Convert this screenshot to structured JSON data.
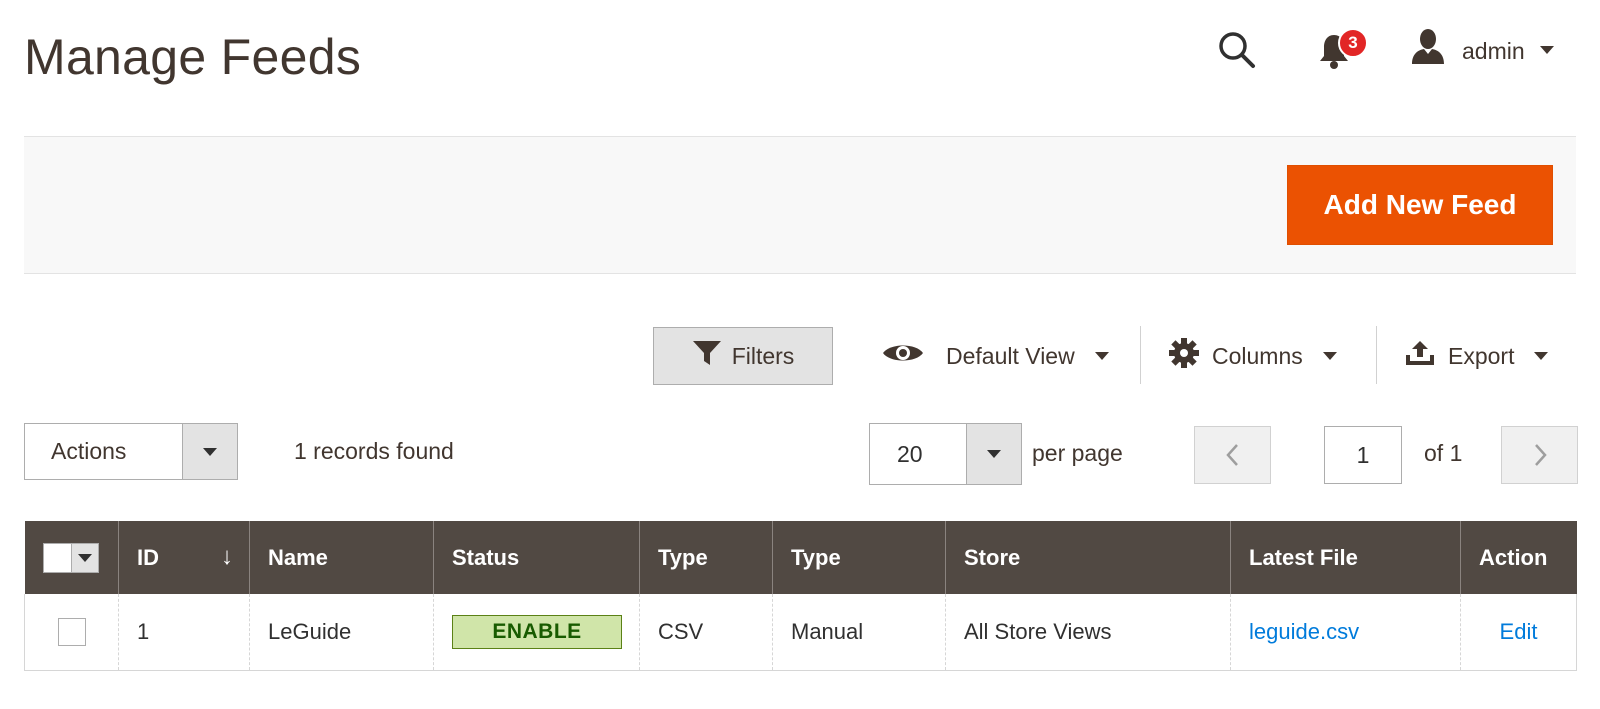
{
  "header": {
    "title": "Manage Feeds",
    "notification_count": "3",
    "user_name": "admin"
  },
  "page_actions": {
    "add_button_label": "Add New Feed"
  },
  "toolbar": {
    "filters_label": "Filters",
    "view_label": "Default View",
    "columns_label": "Columns",
    "export_label": "Export"
  },
  "mass_actions": {
    "label": "Actions",
    "records_found": "1 records found"
  },
  "pager": {
    "per_page_value": "20",
    "per_page_label": "per page",
    "current_page": "1",
    "of_label": "of 1"
  },
  "table": {
    "columns": [
      "ID",
      "Name",
      "Status",
      "Type",
      "Type",
      "Store",
      "Latest File",
      "Action"
    ],
    "rows": [
      {
        "id": "1",
        "name": "LeGuide",
        "status": "ENABLE",
        "type": "CSV",
        "type2": "Manual",
        "store": "All Store Views",
        "latest_file": "leguide.csv",
        "action": "Edit"
      }
    ]
  },
  "colors": {
    "accent": "#eb5202",
    "header_bg": "#514943",
    "badge": "#e22626",
    "link": "#007bdb",
    "status_bg": "#d0e5a9"
  }
}
